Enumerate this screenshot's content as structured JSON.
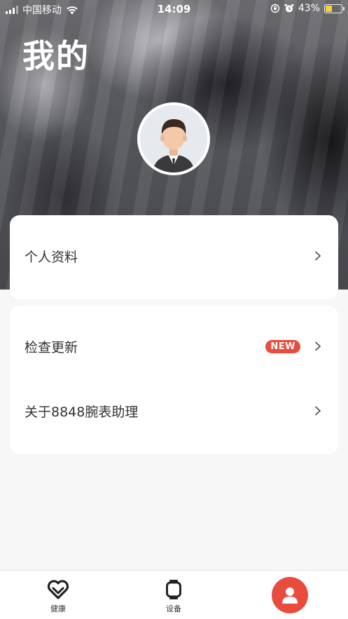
{
  "status_bar": {
    "carrier": "中国移动",
    "time": "14:09",
    "battery": "43%",
    "battery_level": 0.43
  },
  "header": {
    "title": "我的"
  },
  "profile_card": {
    "items": [
      {
        "label": "个人资料",
        "icon": "chevron-right-icon"
      }
    ]
  },
  "settings_card": {
    "items": [
      {
        "label": "检查更新",
        "badge": "NEW",
        "icon": "chevron-right-icon"
      },
      {
        "label": "关于8848腕表助理",
        "icon": "chevron-right-icon"
      }
    ]
  },
  "tab_bar": {
    "tabs": [
      {
        "label": "健康",
        "icon": "heart-icon"
      },
      {
        "label": "设备",
        "icon": "watch-icon"
      },
      {
        "label": "",
        "icon": "user-icon",
        "active": true
      }
    ]
  },
  "colors": {
    "accent": "#e84c3d",
    "background": "#f7f7f7",
    "card": "#ffffff"
  }
}
